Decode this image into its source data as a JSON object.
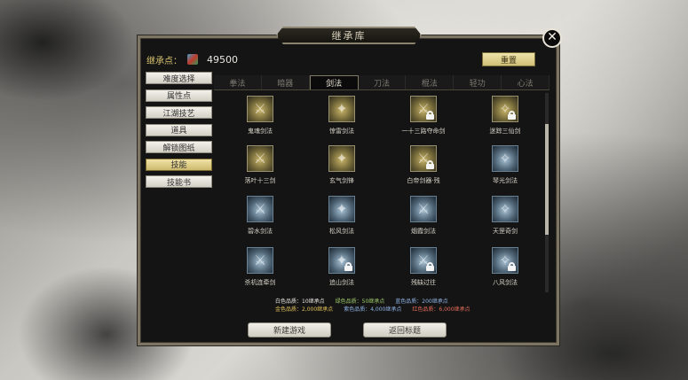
{
  "window": {
    "title": "继承库",
    "close_icon": "close-x-icon"
  },
  "points": {
    "label": "继承点：",
    "value": "49500",
    "icon": "gem-icon"
  },
  "reset_label": "重置",
  "sidebar": {
    "items": [
      {
        "label": "难度选择",
        "active": false
      },
      {
        "label": "属性点",
        "active": false
      },
      {
        "label": "江湖技艺",
        "active": false
      },
      {
        "label": "道具",
        "active": false
      },
      {
        "label": "解锁图纸",
        "active": false
      },
      {
        "label": "技能",
        "active": true
      },
      {
        "label": "技能书",
        "active": false
      }
    ]
  },
  "tabs": [
    {
      "label": "拳法",
      "active": false
    },
    {
      "label": "暗器",
      "active": false
    },
    {
      "label": "剑法",
      "active": true
    },
    {
      "label": "刀法",
      "active": false
    },
    {
      "label": "棍法",
      "active": false
    },
    {
      "label": "轻功",
      "active": false
    },
    {
      "label": "心法",
      "active": false
    }
  ],
  "skills": [
    {
      "name": "鬼魂剑法",
      "locked": false,
      "tone": "gold"
    },
    {
      "name": "惊雷剑法",
      "locked": false,
      "tone": "gold"
    },
    {
      "name": "一十三路夺命剑",
      "locked": true,
      "tone": "gold"
    },
    {
      "name": "迷踪三仙剑",
      "locked": true,
      "tone": "gold"
    },
    {
      "name": "落叶十三剑",
      "locked": false,
      "tone": "gold"
    },
    {
      "name": "玄气剑锋",
      "locked": false,
      "tone": "gold"
    },
    {
      "name": "白帝剑器·残",
      "locked": true,
      "tone": "gold"
    },
    {
      "name": "琴光剑法",
      "locked": false,
      "tone": "blue"
    },
    {
      "name": "碧水剑法",
      "locked": false,
      "tone": "blue"
    },
    {
      "name": "松风剑法",
      "locked": false,
      "tone": "blue"
    },
    {
      "name": "烟霞剑法",
      "locked": false,
      "tone": "blue"
    },
    {
      "name": "天罡奇剑",
      "locked": false,
      "tone": "blue"
    },
    {
      "name": "杀机连牵剑",
      "locked": false,
      "tone": "blue"
    },
    {
      "name": "追山剑法",
      "locked": true,
      "tone": "blue"
    },
    {
      "name": "残缺过往",
      "locked": true,
      "tone": "blue"
    },
    {
      "name": "八风剑法",
      "locked": true,
      "tone": "blue"
    }
  ],
  "scroll": {
    "position": 0.35
  },
  "legend": {
    "row1": [
      {
        "text": "白色品质：10继承点",
        "tone": "white"
      },
      {
        "text": "绿色品质：50继承点",
        "tone": "green"
      },
      {
        "text": "蓝色品质：200继承点",
        "tone": "blue"
      }
    ],
    "row2": [
      {
        "text": "金色品质：2,000继承点",
        "tone": "gold"
      },
      {
        "text": "紫色品质：4,000继承点",
        "tone": "blue"
      },
      {
        "text": "红色品质：6,000继承点",
        "tone": "red"
      }
    ]
  },
  "buttons": {
    "new_game": "新建游戏",
    "back_title": "返回标题"
  }
}
